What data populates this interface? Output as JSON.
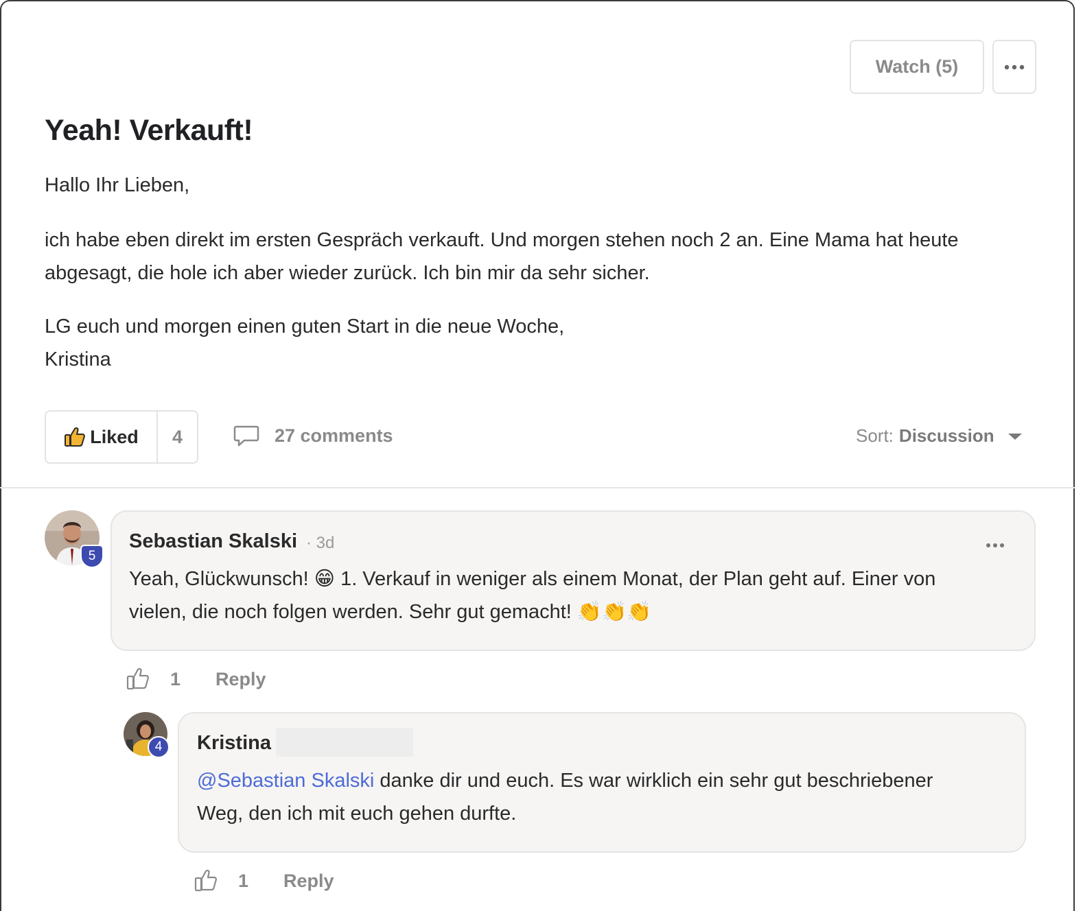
{
  "header": {
    "watch_label": "Watch (5)",
    "more_icon": "ellipsis-icon"
  },
  "post": {
    "title": "Yeah! Verkauft!",
    "greeting": "Hallo Ihr Lieben,",
    "body_line1": "ich habe eben direkt im ersten Gespräch verkauft. Und morgen stehen noch 2 an. Eine Mama hat heute",
    "body_line2": "abgesagt, die hole ich aber wieder zurück. Ich bin mir da sehr sicher.",
    "closing_line1": "LG euch und morgen einen guten Start in die neue Woche,",
    "closing_line2": "Kristina"
  },
  "actions": {
    "liked_label": "Liked",
    "like_count": "4",
    "comments_label": "27 comments",
    "sort_prefix": "Sort:",
    "sort_value": "Discussion"
  },
  "comments": [
    {
      "author": "Sebastian Skalski",
      "separator": "·",
      "time": "3d",
      "level": "5",
      "text_line1_a": "Yeah, Glückwunsch!",
      "emoji1": "😁",
      "text_line1_b": "1. Verkauf in weniger als einem Monat, der Plan geht auf. Einer von",
      "text_line2": "vielen, die noch folgen werden. Sehr gut gemacht!",
      "emoji2": "👏👏👏",
      "like_count": "1",
      "reply_label": "Reply"
    },
    {
      "author": "Kristina",
      "level": "4",
      "mention": "@Sebastian Skalski",
      "text_line1": " danke dir und euch. Es war wirklich ein sehr gut beschriebener",
      "text_line2": "Weg, den ich mit euch gehen durfte.",
      "like_count": "1",
      "reply_label": "Reply"
    }
  ],
  "colors": {
    "accent_badge": "#3d4bb0",
    "mention": "#4d6bd6",
    "muted": "#8a8a8a"
  }
}
